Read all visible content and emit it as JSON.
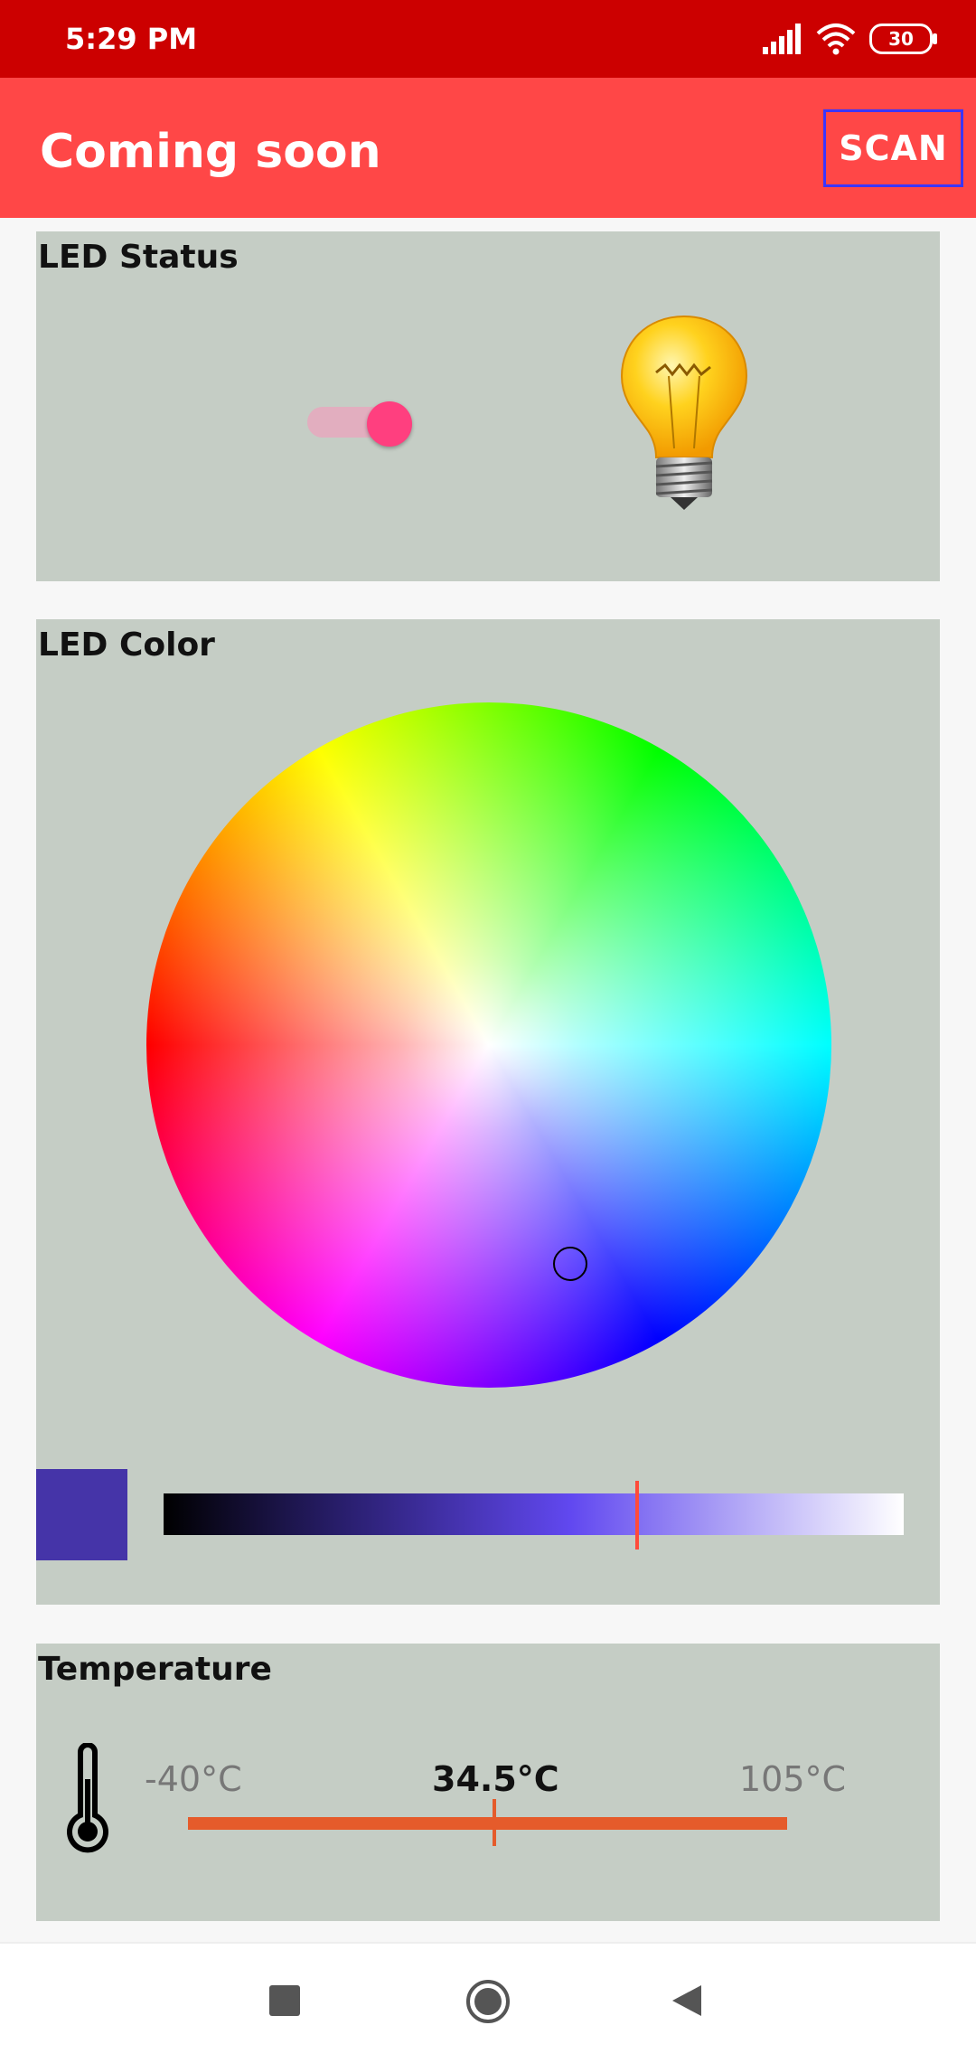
{
  "status_bar": {
    "time": "5:29 PM",
    "battery": "30",
    "icons": [
      "signal-icon",
      "wifi-icon",
      "battery-icon"
    ]
  },
  "app_bar": {
    "title": "Coming soon",
    "action_label": "SCAN",
    "color": "#ff4747"
  },
  "led_status": {
    "label": "LED Status",
    "switch_on": true,
    "icon": "lightbulb-icon"
  },
  "led_color": {
    "label": "LED Color",
    "selected_color": "#4534a8",
    "brightness_fraction": 0.64
  },
  "temperature": {
    "label": "Temperature",
    "min": "-40°C",
    "current": "34.5°C",
    "max": "105°C",
    "icon": "thermometer-icon"
  },
  "nav_bar": {
    "icons": [
      "recents-icon",
      "home-icon",
      "back-icon"
    ]
  }
}
